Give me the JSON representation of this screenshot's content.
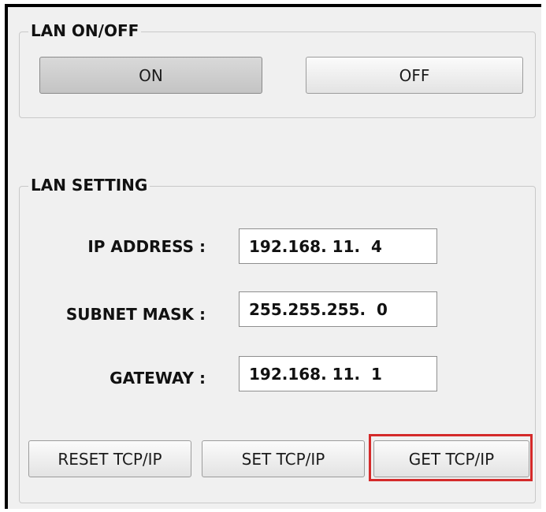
{
  "lan_onoff": {
    "title": "LAN ON/OFF",
    "on_label": "ON",
    "off_label": "OFF"
  },
  "lan_setting": {
    "title": "LAN SETTING",
    "ip_label": "IP ADDRESS :",
    "ip_value": "192.168. 11.  4",
    "subnet_label": "SUBNET MASK :",
    "subnet_value": "255.255.255.  0",
    "gateway_label": "GATEWAY :",
    "gateway_value": "192.168. 11.  1"
  },
  "actions": {
    "reset_label": "RESET TCP/IP",
    "set_label": "SET TCP/IP",
    "get_label": "GET TCP/IP"
  },
  "colors": {
    "highlight": "#d42a2a",
    "panel_bg": "#f0f0f0"
  }
}
